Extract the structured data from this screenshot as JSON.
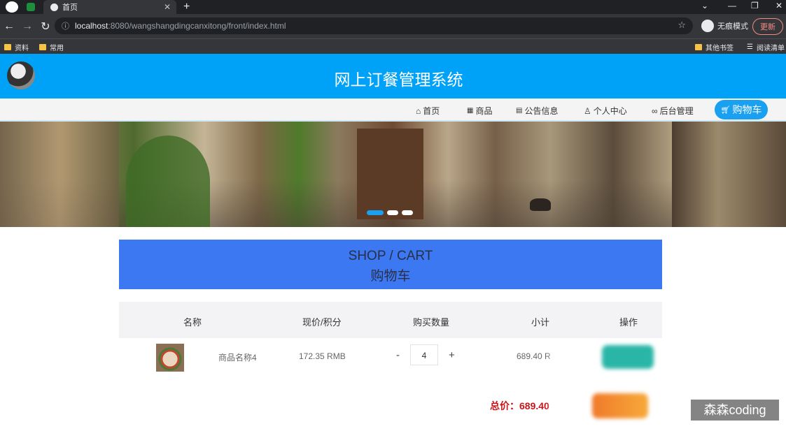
{
  "browser": {
    "tab_title": "首页",
    "url_host": "localhost",
    "url_path": ":8080/wangshangdingcanxitong/front/index.html",
    "incognito_label": "无痕模式",
    "update_label": "更新",
    "bookmarks": [
      "资料",
      "常用"
    ],
    "bookmarks_right": [
      "其他书签",
      "阅读清单"
    ]
  },
  "site": {
    "title": "网上订餐管理系统",
    "accent": "#00a2f7"
  },
  "nav": {
    "items": [
      {
        "label": "首页",
        "icon": "home-icon"
      },
      {
        "label": "商品",
        "icon": "grid-icon"
      },
      {
        "label": "公告信息",
        "icon": "notice-icon"
      },
      {
        "label": "个人中心",
        "icon": "user-icon"
      },
      {
        "label": "后台管理",
        "icon": "link-icon"
      }
    ],
    "cart_label": "购物车"
  },
  "cart": {
    "heading_en": "SHOP / CART",
    "heading_zh": "购物车",
    "columns": [
      "名称",
      "现价/积分",
      "购买数量",
      "小计",
      "操作"
    ],
    "row": {
      "name": "商品名称4",
      "price": "172.35 RMB",
      "minus": "-",
      "quantity": "4",
      "plus": "+",
      "subtotal": "689.40 R"
    },
    "total": "总价：689.40"
  },
  "watermark": "森森coding"
}
